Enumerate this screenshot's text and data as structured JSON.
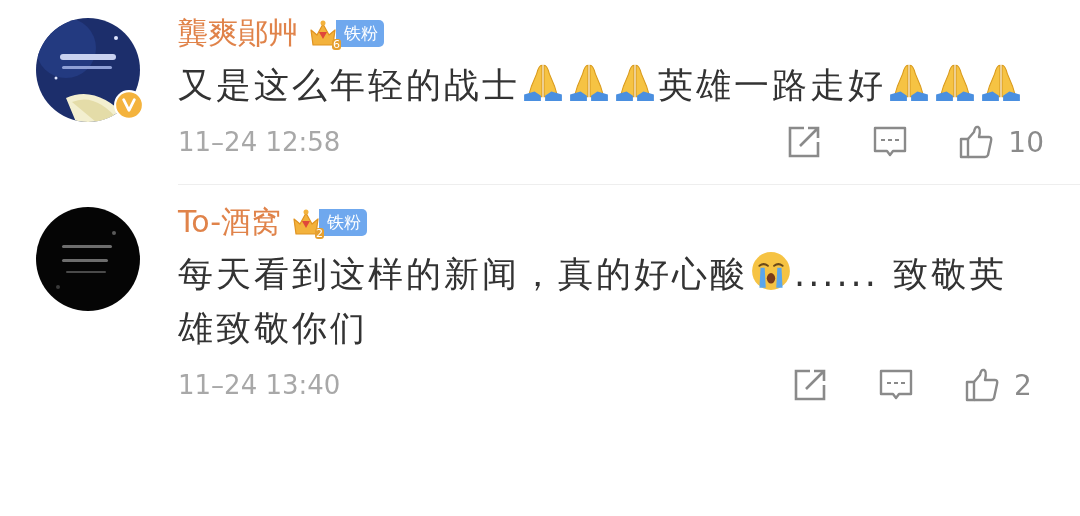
{
  "comments": [
    {
      "author": {
        "name": "龔爽鄖艸",
        "verified": true
      },
      "badge": {
        "level": "6",
        "label": "铁粉"
      },
      "content": [
        {
          "kind": "text",
          "text": "又是这么年轻的战士"
        },
        {
          "kind": "pray"
        },
        {
          "kind": "pray"
        },
        {
          "kind": "pray"
        },
        {
          "kind": "text",
          "text": "英雄一路走好"
        },
        {
          "kind": "pray"
        },
        {
          "kind": "pray"
        },
        {
          "kind": "pray"
        }
      ],
      "time": "11–24 12:58",
      "like_count": "10"
    },
    {
      "author": {
        "name": "To-酒窝",
        "verified": false
      },
      "badge": {
        "level": "2",
        "label": "铁粉"
      },
      "content": [
        {
          "kind": "text",
          "text": "每天看到这样的新闻，真的好心酸"
        },
        {
          "kind": "cry"
        },
        {
          "kind": "text",
          "text": "...... 致敬英雄致敬你们"
        }
      ],
      "time": "11–24 13:40",
      "like_count": "2"
    }
  ]
}
